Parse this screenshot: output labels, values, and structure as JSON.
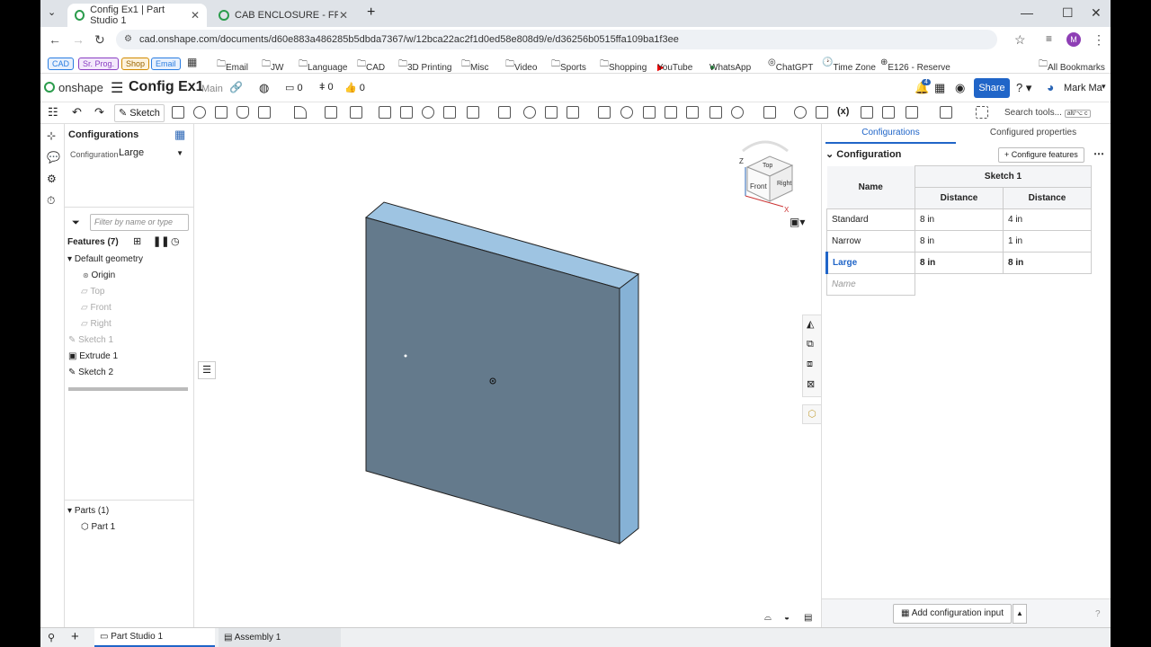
{
  "browser": {
    "tabs": [
      {
        "label": "Config Ex1 | Part Studio 1",
        "active": true
      },
      {
        "label": "CAB ENCLOSURE - FRONT CEN",
        "active": false
      }
    ],
    "url": "cad.onshape.com/documents/d60e883a486285b5dbda7367/w/12bca22ac2f1d0ed58e808d9/e/d36256b0515ffa109ba1f3ee",
    "profile_initial": "M",
    "bookmark_pills": [
      {
        "label": "CAD",
        "color": "#2a7de1"
      },
      {
        "label": "Sr. Prog.",
        "color": "#8a3fc2"
      },
      {
        "label": "Shop",
        "color": "#d18a00"
      },
      {
        "label": "Email",
        "color": "#2a7de1"
      }
    ],
    "bookmarks": [
      "Email",
      "JW",
      "Language",
      "CAD",
      "3D Printing",
      "Misc",
      "Video",
      "Sports",
      "Shopping",
      "YouTube",
      "WhatsApp",
      "ChatGPT",
      "Time Zone",
      "E126 - Reserve"
    ],
    "all_bookmarks": "All Bookmarks"
  },
  "header": {
    "logo": "onshape",
    "doc_title": "Config Ex1",
    "branch": "Main",
    "counts": [
      "0",
      "0",
      "0"
    ],
    "notifications": "4",
    "share_label": "Share",
    "user": "Mark Ma"
  },
  "toolbar": {
    "sketch_label": "Sketch",
    "search_placeholder": "Search tools...",
    "search_hotkey": "alt/⌥ c"
  },
  "left_panel": {
    "configurations_title": "Configurations",
    "configuration_label": "Configuration",
    "configuration_value": "Large",
    "filter_placeholder": "Filter by name or type",
    "features_header": "Features (7)",
    "default_geometry": "Default geometry",
    "origin": "Origin",
    "planes": [
      "Top",
      "Front",
      "Right"
    ],
    "features": [
      "Sketch 1",
      "Extrude 1",
      "Sketch 2"
    ],
    "parts_header": "Parts (1)",
    "parts": [
      "Part 1"
    ]
  },
  "viewcube": {
    "top": "Top",
    "front": "Front",
    "right": "Right",
    "z": "Z",
    "x": "X"
  },
  "right_panel": {
    "tab_configurations": "Configurations",
    "tab_configured_properties": "Configured properties",
    "section_title": "Configuration",
    "configure_features_label": "Configure features",
    "group_header": "Sketch 1",
    "col_name": "Name",
    "col_distance_1": "Distance",
    "col_distance_2": "Distance",
    "rows": [
      {
        "name": "Standard",
        "d1": "8 in",
        "d2": "4 in",
        "selected": false
      },
      {
        "name": "Narrow",
        "d1": "8 in",
        "d2": "1 in",
        "selected": false
      },
      {
        "name": "Large",
        "d1": "8 in",
        "d2": "8 in",
        "selected": true
      }
    ],
    "new_row_placeholder": "Name",
    "add_input_label": "Add configuration input"
  },
  "bottom_tabs": [
    {
      "label": "Part Studio 1",
      "active": true
    },
    {
      "label": "Assembly 1",
      "active": false
    }
  ]
}
